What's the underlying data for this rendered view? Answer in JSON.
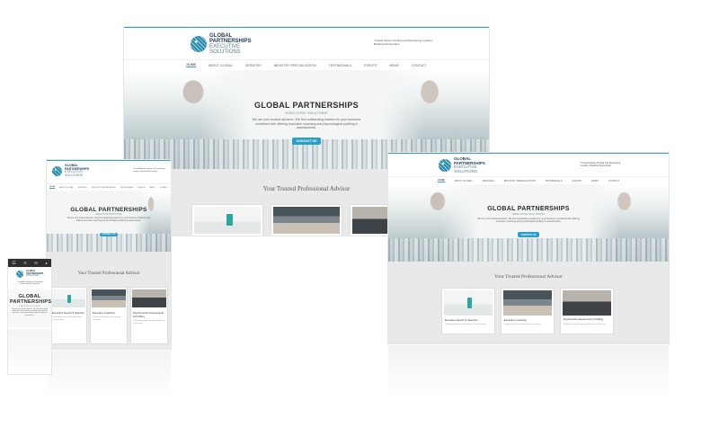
{
  "site": {
    "brand_line1": "GLOBAL",
    "brand_line2": "PARTNERSHIPS",
    "brand_line3": "EXECUTIVE",
    "brand_line4": "SOLUTIONS",
    "tagline": "Trusted Advisor Finding and Developing Leaders, Building Partnerships",
    "nav": [
      "HOME",
      "ABOUT GLOBAL",
      "SERVICES",
      "INDUSTRY SPECIALIZATION",
      "TESTIMONIALS",
      "EVENTS",
      "NEWS",
      "CONTACT"
    ],
    "hero_title": "GLOBAL PARTNERSHIPS",
    "hero_subtitle": "EXECUTIVE SOLUTIONS",
    "hero_body": "We are your trusted advisors. We find outstanding leaders for your business combined with offering executive coaching and psychological profiling & assessments.",
    "cta_label": "CONTACT US",
    "section_title": "Your Trusted Professional Advisor",
    "cards": [
      {
        "title": "Executive Search & Selection",
        "text": "Outstanding leaders will be identified and evaluated."
      },
      {
        "title": "Executive Coaching",
        "text": "Unlock your potential with executive coaching."
      },
      {
        "title": "Psychometric Assessments & Profiling",
        "text": "Insight into people through profiling and assessment."
      }
    ]
  },
  "colors": {
    "accent": "#2a9ec9",
    "brand_dark": "#1d3d55",
    "section_bg": "#e9e9e9"
  },
  "icons": [
    "globe-logo-icon",
    "menu-icon"
  ]
}
